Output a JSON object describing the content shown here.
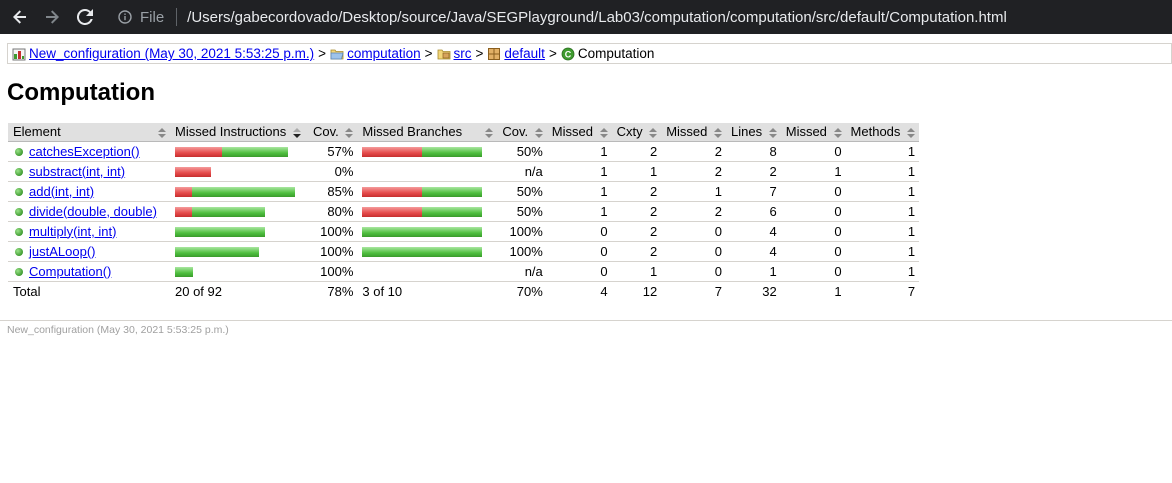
{
  "browser": {
    "file_label": "File",
    "url": "/Users/gabecordovado/Desktop/source/Java/SEGPlayground/Lab03/computation/computation/src/default/Computation.html"
  },
  "breadcrumb": {
    "session": "New_configuration (May 30, 2021 5:53:25 p.m.)",
    "project": "computation",
    "src": "src",
    "package": "default",
    "current": "Computation",
    "separator": ">"
  },
  "page_title": "Computation",
  "table": {
    "headers": {
      "element": "Element",
      "missed_instructions": "Missed Instructions",
      "cov1": "Cov.",
      "missed_branches": "Missed Branches",
      "cov2": "Cov.",
      "missed_cxty": "Missed",
      "cxty": "Cxty",
      "missed_lines": "Missed",
      "lines": "Lines",
      "missed_methods": "Missed",
      "methods": "Methods"
    },
    "rows": [
      {
        "name": "catchesException()",
        "instr_red": 47,
        "instr_green": 66,
        "instr_cov": "57%",
        "br_red": 60,
        "br_green": 60,
        "br_cov": "50%",
        "cx_missed": "1",
        "cx": "2",
        "ln_missed": "2",
        "ln": "8",
        "m_missed": "0",
        "m": "1"
      },
      {
        "name": "substract(int, int)",
        "instr_red": 36,
        "instr_green": 0,
        "instr_cov": "0%",
        "br_red": 0,
        "br_green": 0,
        "br_cov": "n/a",
        "cx_missed": "1",
        "cx": "1",
        "ln_missed": "2",
        "ln": "2",
        "m_missed": "1",
        "m": "1"
      },
      {
        "name": "add(int, int)",
        "instr_red": 17,
        "instr_green": 103,
        "instr_cov": "85%",
        "br_red": 60,
        "br_green": 60,
        "br_cov": "50%",
        "cx_missed": "1",
        "cx": "2",
        "ln_missed": "1",
        "ln": "7",
        "m_missed": "0",
        "m": "1"
      },
      {
        "name": "divide(double, double)",
        "instr_red": 17,
        "instr_green": 73,
        "instr_cov": "80%",
        "br_red": 60,
        "br_green": 60,
        "br_cov": "50%",
        "cx_missed": "1",
        "cx": "2",
        "ln_missed": "2",
        "ln": "6",
        "m_missed": "0",
        "m": "1"
      },
      {
        "name": "multiply(int, int)",
        "instr_red": 0,
        "instr_green": 90,
        "instr_cov": "100%",
        "br_red": 0,
        "br_green": 120,
        "br_cov": "100%",
        "cx_missed": "0",
        "cx": "2",
        "ln_missed": "0",
        "ln": "4",
        "m_missed": "0",
        "m": "1"
      },
      {
        "name": "justALoop()",
        "instr_red": 0,
        "instr_green": 84,
        "instr_cov": "100%",
        "br_red": 0,
        "br_green": 120,
        "br_cov": "100%",
        "cx_missed": "0",
        "cx": "2",
        "ln_missed": "0",
        "ln": "4",
        "m_missed": "0",
        "m": "1"
      },
      {
        "name": "Computation()",
        "instr_red": 0,
        "instr_green": 18,
        "instr_cov": "100%",
        "br_red": 0,
        "br_green": 0,
        "br_cov": "n/a",
        "cx_missed": "0",
        "cx": "1",
        "ln_missed": "0",
        "ln": "1",
        "m_missed": "0",
        "m": "1"
      }
    ],
    "total": {
      "label": "Total",
      "instr": "20 of 92",
      "instr_cov": "78%",
      "br": "3 of 10",
      "br_cov": "70%",
      "cx_missed": "4",
      "cx": "12",
      "ln_missed": "7",
      "ln": "32",
      "m_missed": "1",
      "m": "7"
    }
  },
  "footer": "New_configuration (May 30, 2021 5:53:25 p.m.)",
  "colors": {
    "chrome_bg": "#202124",
    "header_bg": "#e0e0e0",
    "link": "#0000ee",
    "bar_red": "#e54a4a",
    "bar_green": "#4fbf3f"
  }
}
